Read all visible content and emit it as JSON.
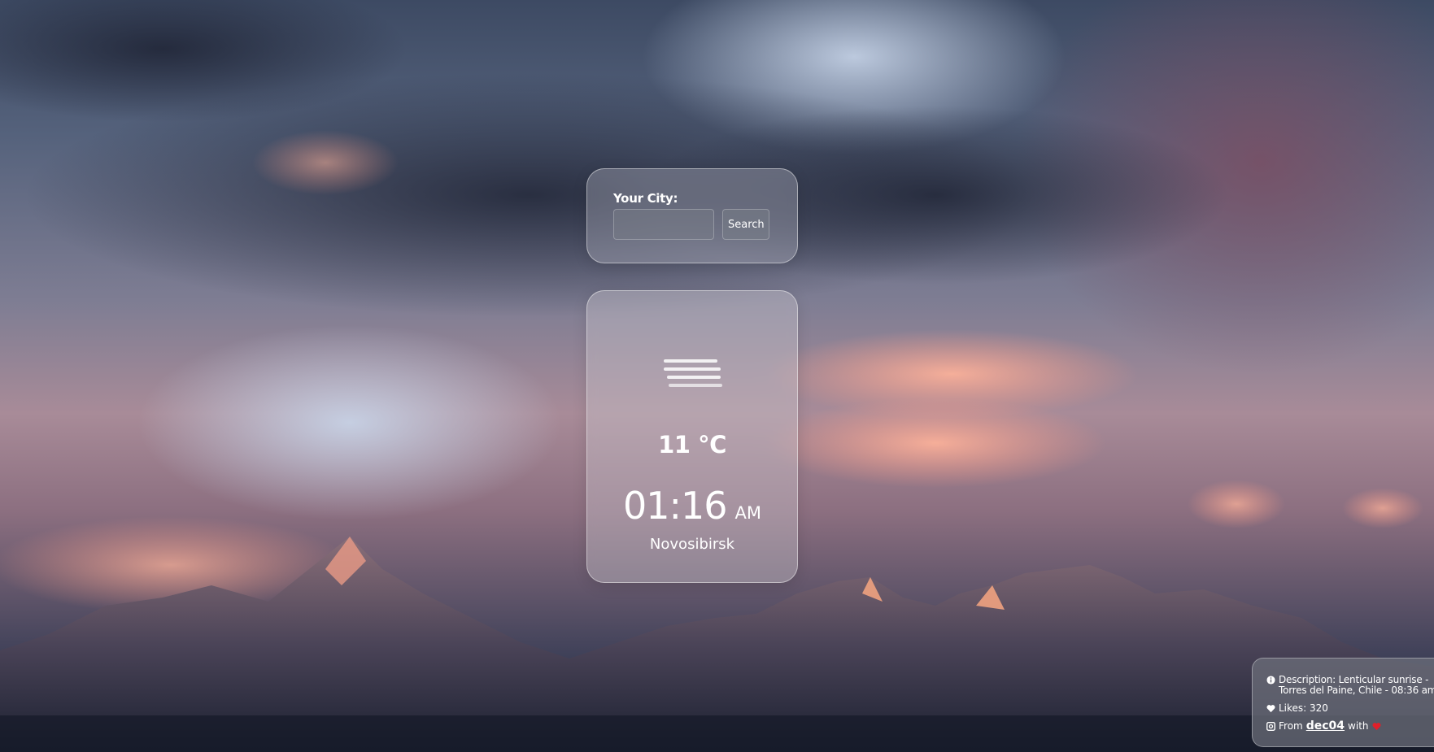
{
  "search": {
    "label": "Your City:",
    "input_value": "",
    "input_placeholder": "",
    "button_label": "Search"
  },
  "weather": {
    "icon": "mist-icon",
    "temperature": "11 °C",
    "time": "01:16",
    "ampm": "AM",
    "city": "Novosibirsk"
  },
  "photo_info": {
    "description": "Description: Lenticular sunrise - Torres del Paine, Chile - 08:36 am",
    "likes": "Likes: 320",
    "from_prefix": "From",
    "author": "dec04",
    "with_text": "with",
    "icons": [
      "info-icon",
      "heart-icon",
      "camera-icon",
      "heart-red-icon"
    ]
  },
  "colors": {
    "heart": "#e0202a",
    "card_text": "#ffffff"
  }
}
